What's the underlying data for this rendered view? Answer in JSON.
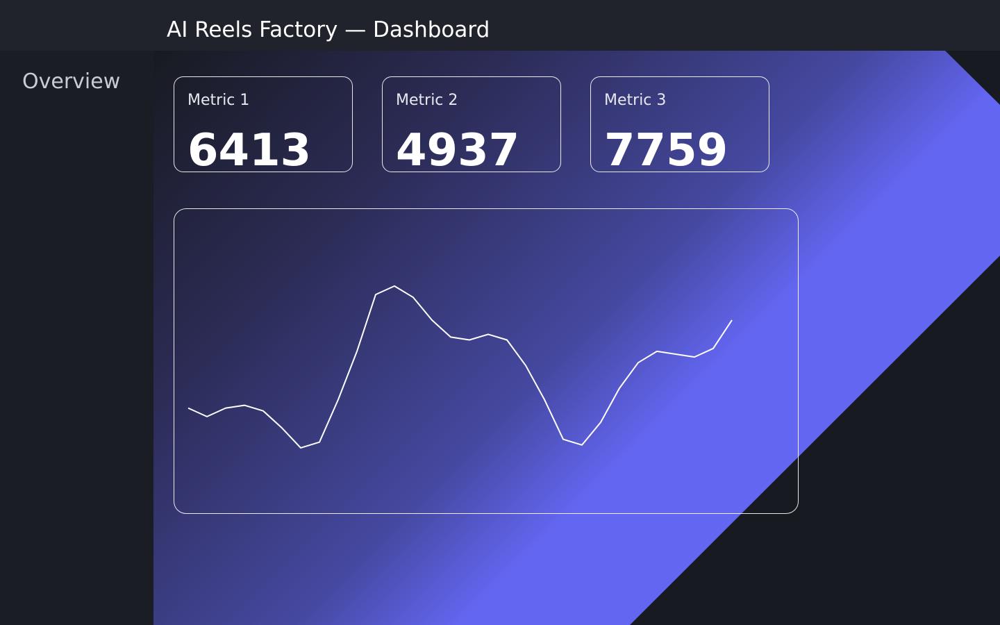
{
  "header": {
    "title": "AI Reels Factory — Dashboard"
  },
  "sidebar": {
    "items": [
      {
        "label": "Overview"
      }
    ]
  },
  "metrics": [
    {
      "label": "Metric 1",
      "value": "6413"
    },
    {
      "label": "Metric 2",
      "value": "4937"
    },
    {
      "label": "Metric 3",
      "value": "7759"
    }
  ],
  "colors": {
    "header_bg": "#20232b",
    "sidebar_bg": "#1b1d24",
    "page_bg": "#181a21",
    "accent": "#6366f1",
    "line": "#ffffff"
  },
  "chart_data": {
    "type": "line",
    "x": [
      0,
      1,
      2,
      3,
      4,
      5,
      6,
      7,
      8,
      9,
      10,
      11,
      12,
      13,
      14,
      15,
      16,
      17,
      18,
      19,
      20,
      21,
      22,
      23,
      24,
      25,
      26,
      27,
      28,
      29
    ],
    "series": [
      {
        "values": [
          57,
          54,
          57,
          58,
          56,
          50,
          43,
          45,
          60,
          77,
          97,
          100,
          96,
          88,
          82,
          81,
          83,
          81,
          72,
          60,
          46,
          44,
          52,
          64,
          73,
          77,
          76,
          75,
          78,
          88
        ]
      }
    ],
    "ylim": [
      30,
      110
    ],
    "grid": false,
    "legend": "none"
  }
}
